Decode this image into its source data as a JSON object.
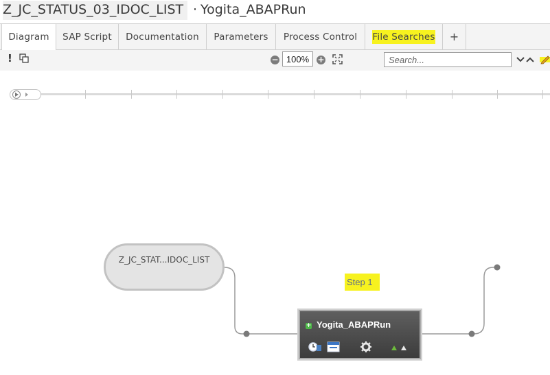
{
  "title": {
    "name": "Z_JC_STATUS_03_IDOC_LIST",
    "separator": "·",
    "subtitle": "Yogita_ABAPRun"
  },
  "tabs": [
    {
      "label": "Diagram",
      "active": true
    },
    {
      "label": "SAP Script"
    },
    {
      "label": "Documentation"
    },
    {
      "label": "Parameters"
    },
    {
      "label": "Process Control"
    },
    {
      "label": "File Searches",
      "highlighted": true
    },
    {
      "label": "+"
    }
  ],
  "toolbar": {
    "alert_icon": "!",
    "copy_icon": "copy-icon",
    "zoom_value": "100%",
    "search_placeholder": "Search...",
    "nav_down_icon": "chevron-down-icon",
    "nav_up_icon": "chevron-up-icon",
    "edit_icon": "pencil-icon"
  },
  "diagram": {
    "start_node_label": "Z_JC_STAT...IDOC_LIST",
    "step_label": "Step 1",
    "step_node_title": "Yogita_ABAPRun",
    "highlight_color": "#f7f21f",
    "node_color": "#4a4a4a"
  }
}
